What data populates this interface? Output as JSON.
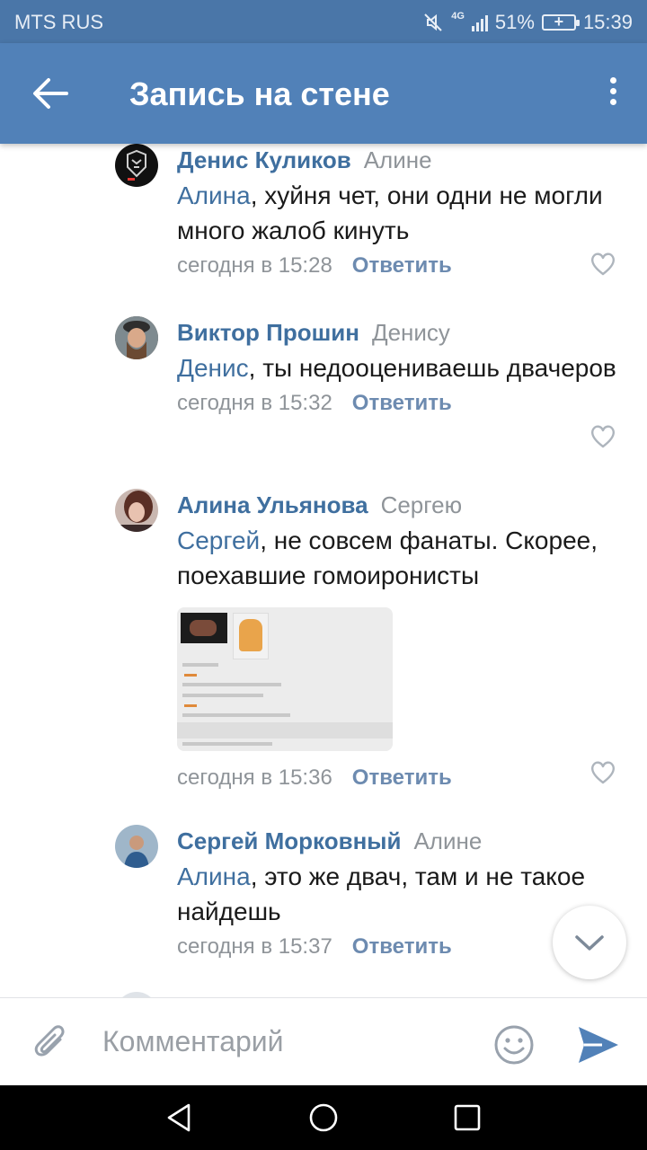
{
  "status_bar": {
    "carrier": "MTS RUS",
    "network": "4G",
    "battery": "51%",
    "time": "15:39"
  },
  "app_bar": {
    "title": "Запись на стене"
  },
  "comments": [
    {
      "author": "Денис Куликов",
      "reply_to": "Алине",
      "mention": "Алина",
      "text": ", хуйня чет, они одни не могли много жалоб кинуть",
      "time": "сегодня в 15:28",
      "reply_label": "Ответить"
    },
    {
      "author": "Виктор Прошин",
      "reply_to": "Денису",
      "mention": "Денис",
      "text": ", ты недооцениваешь двачеров",
      "time": "сегодня в 15:32",
      "reply_label": "Ответить"
    },
    {
      "author": "Алина Ульянова",
      "reply_to": "Сергею",
      "mention": "Сергей",
      "text": ", не совсем фанаты. Скорее, поехавшие гомоиронисты",
      "time": "сегодня в 15:36",
      "reply_label": "Ответить",
      "has_attachment": true
    },
    {
      "author": "Сергей Морковный",
      "reply_to": "Алине",
      "mention": "Алина",
      "text": ", это же двач, там и не такое найдешь",
      "time": "сегодня в 15:37",
      "reply_label": "Ответить"
    }
  ],
  "composer": {
    "placeholder": "Комментарий"
  },
  "icons": {
    "back": "arrow-left-icon",
    "more": "more-vertical-icon",
    "like": "heart-icon",
    "attach": "paperclip-icon",
    "emoji": "smile-icon",
    "send": "send-icon",
    "scroll": "chevron-down-icon"
  },
  "colors": {
    "header_bg": "#5181b8",
    "link": "#3f6f9f",
    "secondary_text": "#8f9499"
  }
}
